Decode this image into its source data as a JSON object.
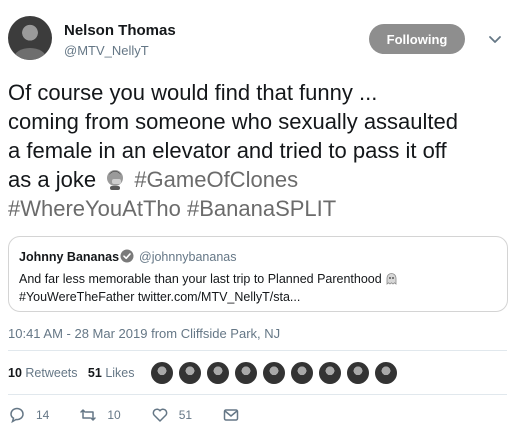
{
  "author": {
    "name": "Nelson Thomas",
    "handle": "@MTV_NellyT",
    "follow_label": "Following"
  },
  "tweet": {
    "text_line1": "Of course you would find that funny ...",
    "text_line2": "coming from someone who sexually assaulted",
    "text_line3": "a female in an elevator and tried to pass it off",
    "text_line4_prefix": "as a joke",
    "emoji_icon": "facepalm-emoji-icon",
    "hashtag1": "#GameOfClones",
    "hashtag2": "#WhereYouAtTho",
    "hashtag3": "#BananaSPLIT"
  },
  "quote": {
    "name": "Johnny Bananas",
    "handle": "@johnnybananas",
    "text_line1": "And far less memorable than your last trip to Planned Parenthood",
    "text_line2": "#YouWereTheFather twitter.com/MTV_NellyT/sta..."
  },
  "timestamp": "10:41 AM - 28 Mar 2019 from Cliffside Park, NJ",
  "stats": {
    "retweets_count": "10",
    "retweets_label": "Retweets",
    "likes_count": "51",
    "likes_label": "Likes",
    "liker_avatar_count": 9
  },
  "actions": {
    "reply_count": "14",
    "retweet_count": "10",
    "like_count": "51"
  },
  "colors": {
    "link": "#6b6b6b",
    "secondary_text": "#657786",
    "follow_button": "#8e8e8e"
  }
}
